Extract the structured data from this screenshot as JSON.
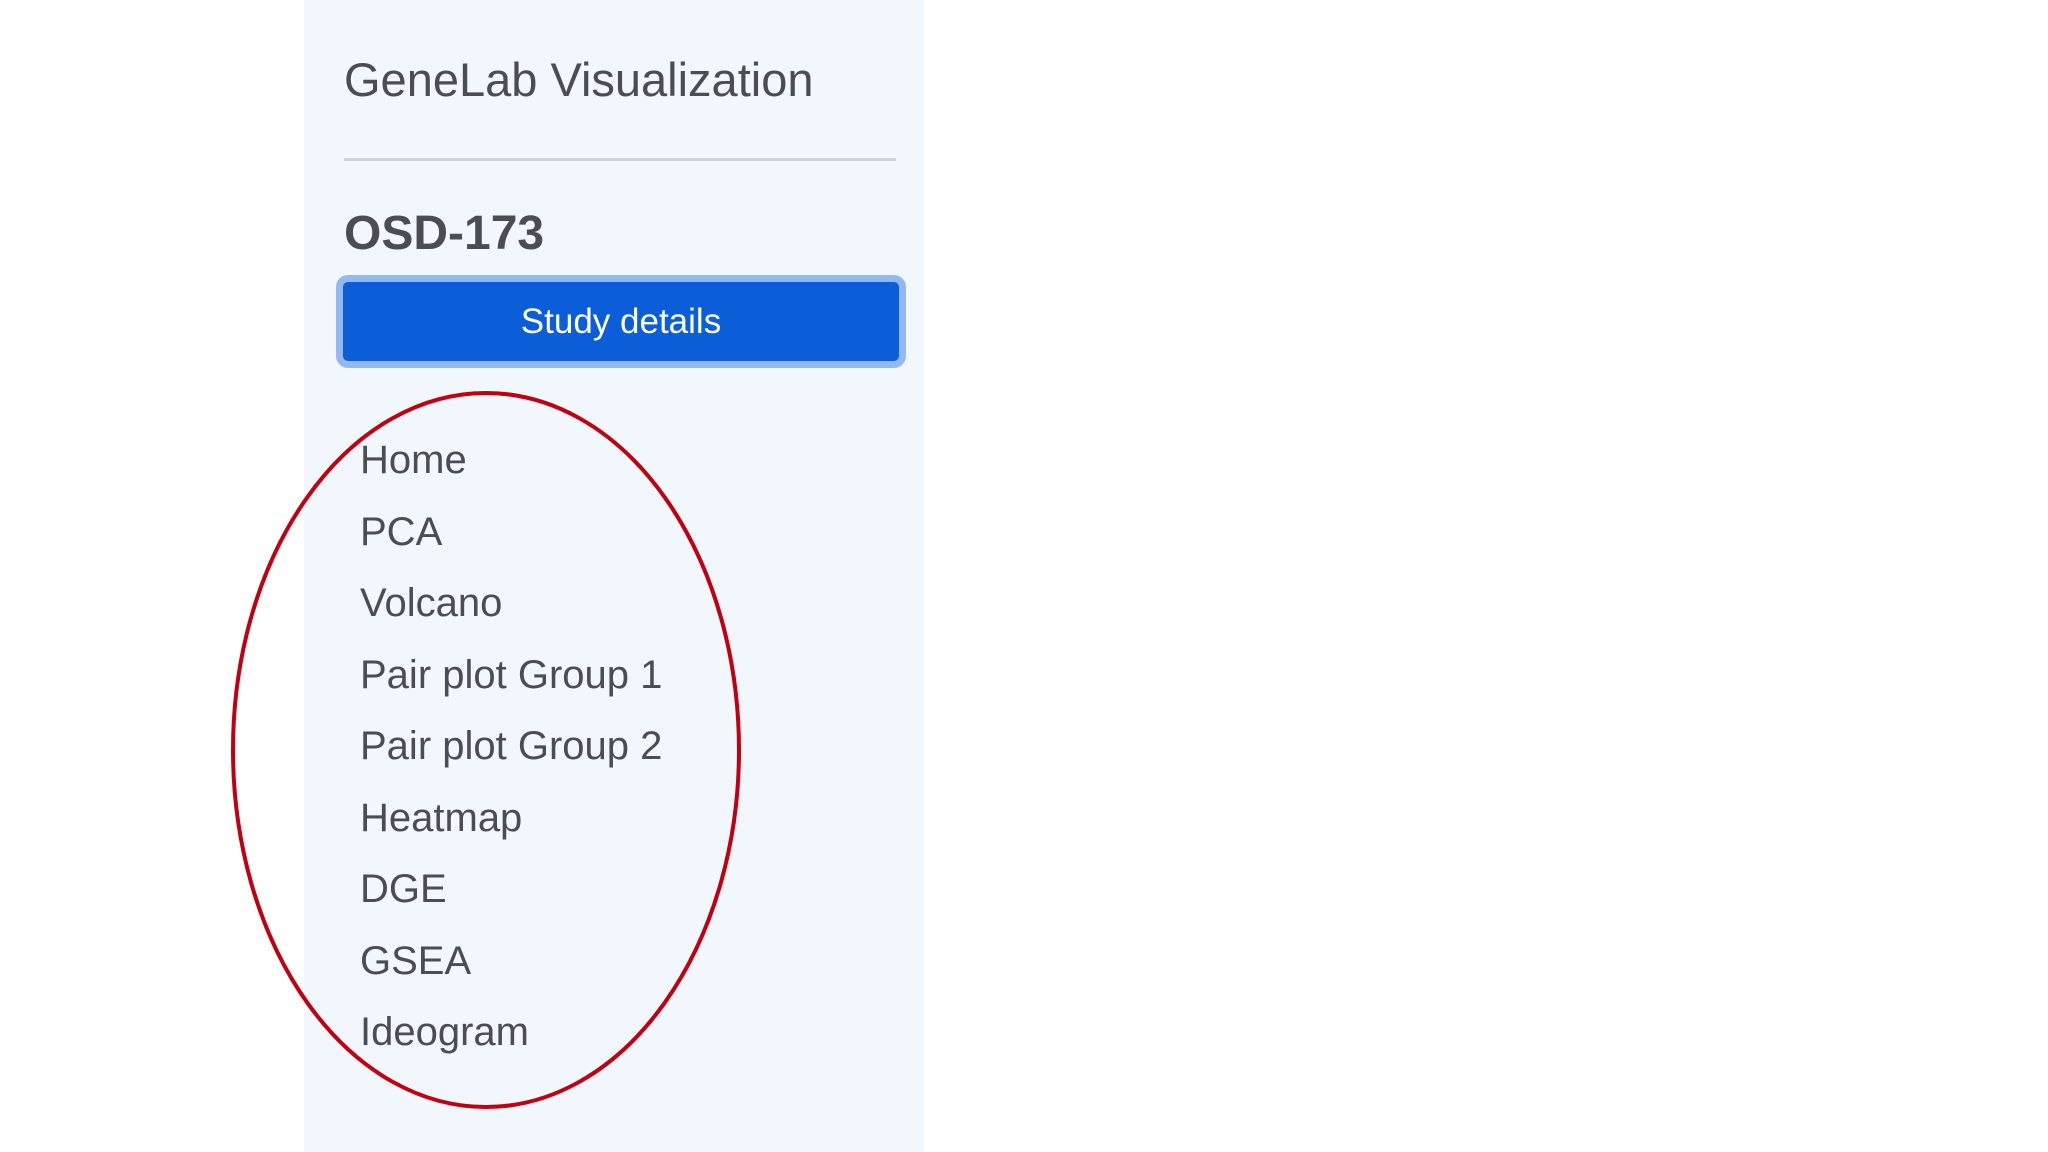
{
  "sidebar": {
    "app_title": "GeneLab Visualization",
    "study_id": "OSD-173",
    "study_button_label": "Study details",
    "nav_items": [
      {
        "label": "Home"
      },
      {
        "label": "PCA"
      },
      {
        "label": "Volcano"
      },
      {
        "label": "Pair plot Group 1"
      },
      {
        "label": "Pair plot Group 2"
      },
      {
        "label": "Heatmap"
      },
      {
        "label": "DGE"
      },
      {
        "label": "GSEA"
      },
      {
        "label": "Ideogram"
      }
    ]
  },
  "colors": {
    "sidebar_background": "#f2f6fd",
    "primary_button": "#0b5ed7",
    "button_focus_ring": "#93b8f5",
    "text": "#4a4d52",
    "annotation_ellipse": "#c00010"
  }
}
